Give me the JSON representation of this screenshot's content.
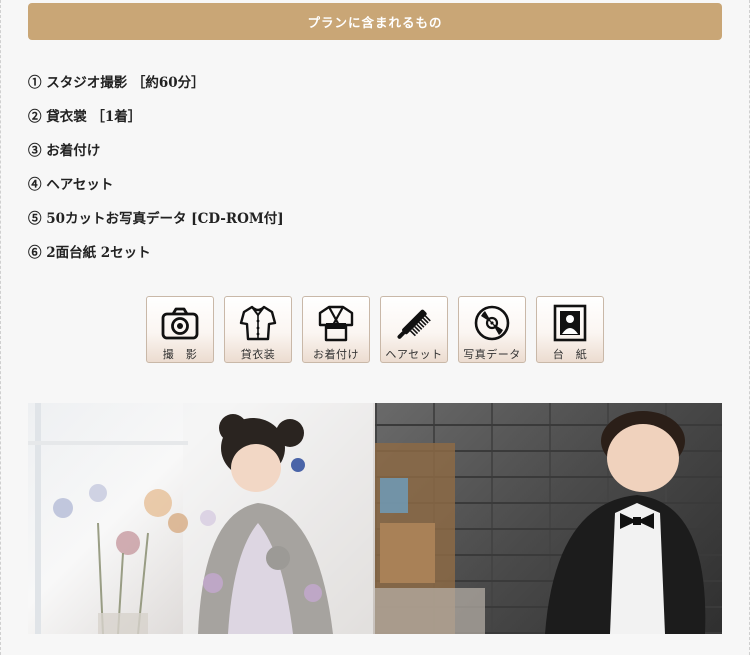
{
  "banner": {
    "title": "プランに含まれるもの"
  },
  "plan_items": [
    "① スタジオ撮影 ［約60分］",
    "② 貸衣裳 ［1着］",
    "③ お着付け",
    "④ ヘアセット",
    "⑤ 50カットお写真データ [CD-ROM付]",
    "⑥ 2面台紙 2セット"
  ],
  "icons": [
    {
      "icon": "camera-icon",
      "label": "撮　影"
    },
    {
      "icon": "shirt-icon",
      "label": "貸衣装"
    },
    {
      "icon": "kimono-icon",
      "label": "お着付け"
    },
    {
      "icon": "comb-icon",
      "label": "ヘアセット"
    },
    {
      "icon": "cd-icon",
      "label": "写真データ"
    },
    {
      "icon": "mount-icon",
      "label": "台　紙"
    }
  ],
  "colors": {
    "banner": "#c9a676",
    "background": "#f7f7f7"
  }
}
